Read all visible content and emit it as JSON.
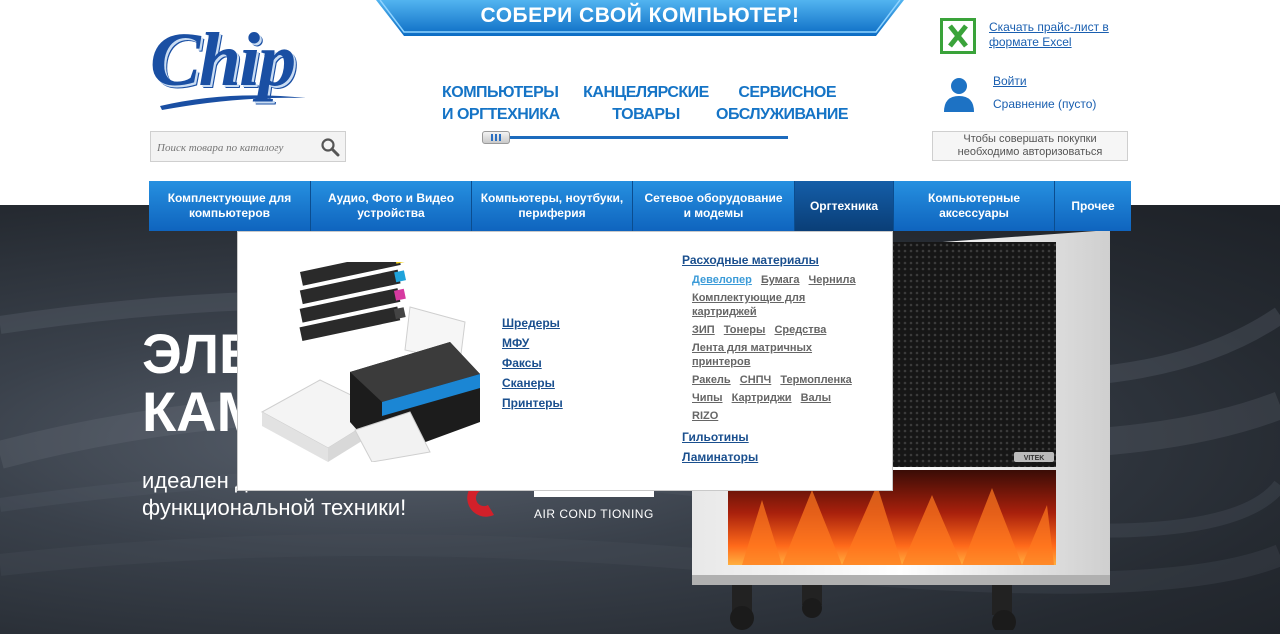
{
  "header": {
    "logo_text": "Chip",
    "banner": "СОБЕРИ СВОЙ КОМПЬЮТЕР!",
    "categories": [
      "КОМПЬЮТЕРЫ\nИ ОРГТЕХНИКА",
      "КАНЦЕЛЯРСКИЕ\nТОВАРЫ",
      "СЕРВИСНОЕ\nОБСЛУЖИВАНИЕ"
    ],
    "search_placeholder": "Поиск товара по каталогу",
    "excel_link": "Скачать прайс-лист в формате Excel",
    "login_link": "Войти",
    "compare_link": "Сравнение (пусто)",
    "auth_note": "Чтобы совершать покупки необходимо авторизоваться"
  },
  "nav": {
    "items": [
      "Комплектующие для\nкомпьютеров",
      "Аудио, Фото и Видео\nустройства",
      "Компьютеры, ноутбуки,\nпериферия",
      "Сетевое оборудование\nи модемы",
      "Оргтехника",
      "Компьютерные\nаксессуары",
      "Прочее"
    ],
    "active_index": 4
  },
  "dropdown": {
    "col1": [
      "Шредеры",
      "МФУ",
      "Факсы",
      "Сканеры",
      "Принтеры"
    ],
    "consumables_heading": "Расходные материалы",
    "consumables": {
      "row1": [
        "Девелопер",
        "Бумага",
        "Чернила"
      ],
      "row2": [
        "Комплектующие для картриджей"
      ],
      "row3": [
        "ЗИП",
        "Тонеры",
        "Средства"
      ],
      "row4": [
        "Лента для матричных принтеров"
      ],
      "row5": [
        "Ракель",
        "СНПЧ",
        "Термопленка"
      ],
      "row6": [
        "Чипы",
        "Картриджи",
        "Валы"
      ],
      "row7": [
        "RIZO"
      ]
    },
    "other_headings": [
      "Гильотины",
      "Ламинаторы"
    ]
  },
  "hero": {
    "title": "ЭЛЕ\nКАМ",
    "subtitle": "идеален дл\nфункциональной техники!",
    "brand_caption": "AIR COND TIONING",
    "heater_label": "VITEK"
  },
  "colors": {
    "brand_blue": "#1a4fa3",
    "nav_blue": "#1670cc",
    "nav_active": "#0c4785",
    "link": "#1a4f8e",
    "highlight_link": "#3b9bd8"
  }
}
